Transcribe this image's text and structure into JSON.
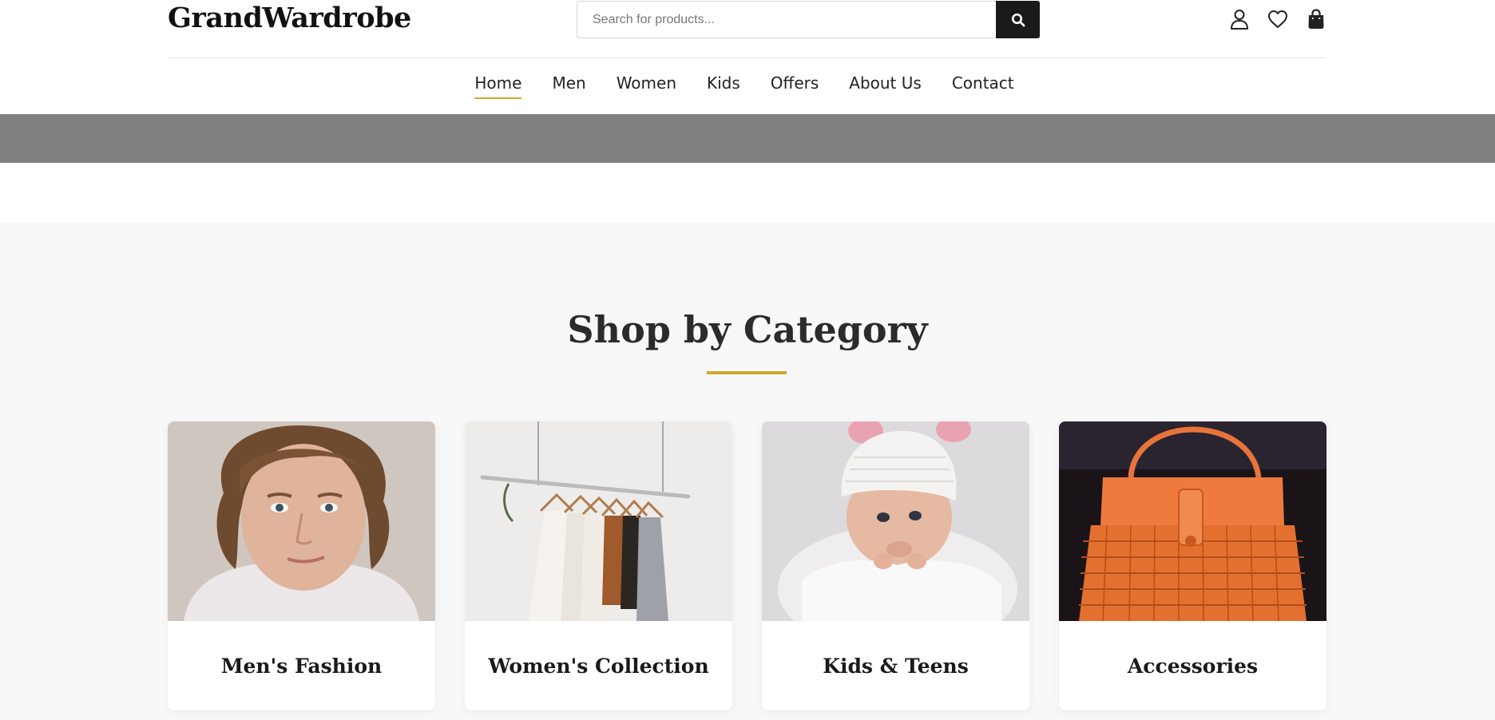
{
  "brand": "GrandWardrobe",
  "search": {
    "placeholder": "Search for products..."
  },
  "header_icons": [
    "user-icon",
    "heart-icon",
    "shopping-bag-icon"
  ],
  "nav": {
    "items": [
      {
        "label": "Home",
        "active": true
      },
      {
        "label": "Men",
        "active": false
      },
      {
        "label": "Women",
        "active": false
      },
      {
        "label": "Kids",
        "active": false
      },
      {
        "label": "Offers",
        "active": false
      },
      {
        "label": "About Us",
        "active": false
      },
      {
        "label": "Contact",
        "active": false
      }
    ]
  },
  "categories_section": {
    "title": "Shop by Category",
    "cards": [
      {
        "label": "Men's Fashion"
      },
      {
        "label": "Women's Collection"
      },
      {
        "label": "Kids & Teens"
      },
      {
        "label": "Accessories"
      }
    ]
  },
  "colors": {
    "accent": "#d4a72c",
    "dark": "#1a1a1a",
    "banner": "#7f7f7f",
    "section_bg": "#f8f8f8"
  }
}
